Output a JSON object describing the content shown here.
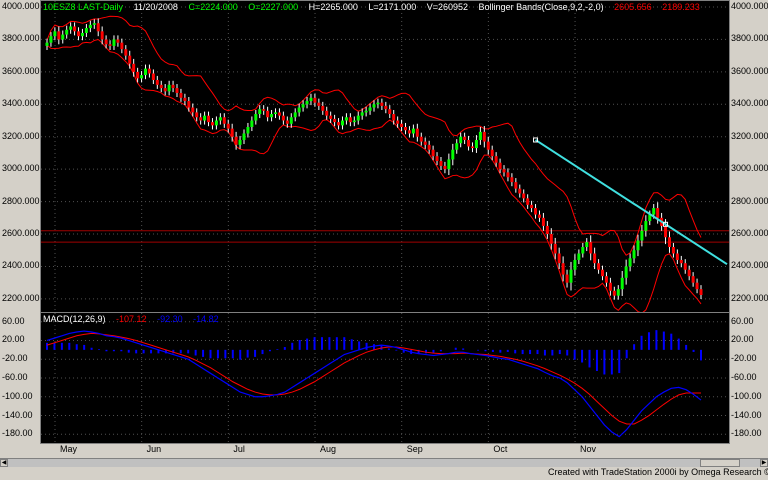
{
  "price_pane": {
    "header": {
      "symbol": "10ESZ8 LAST-Daily",
      "date": "11/20/2008",
      "close": "C=2224.000",
      "open": "O=2227.000",
      "high": "H=2265.000",
      "low": "L=2171.000",
      "volume": "V=260952",
      "indicator": "Bollinger Bands(Close,9,2,-2,0)",
      "upper": "2605.656",
      "lower": "2189.233"
    },
    "y_ticks": [
      "4000.000",
      "3800.000",
      "3600.000",
      "3400.000",
      "3200.000",
      "3000.000",
      "2800.000",
      "2600.000",
      "2400.000",
      "2200.000"
    ]
  },
  "macd_pane": {
    "header": {
      "label": "MACD(12,26,9)",
      "macd": "-107.12",
      "signal": "-92.30",
      "diff": "-14.82"
    },
    "y_ticks": [
      "60.00",
      "20.00",
      "-20.00",
      "-60.00",
      "-100.00",
      "-140.00",
      "-180.00"
    ]
  },
  "x_ticks": [
    "May",
    "Jun",
    "Jul",
    "Aug",
    "Sep",
    "Oct",
    "Nov"
  ],
  "footer": "Created with TradeStation 2000i by Omega Research © 1999",
  "colors": {
    "up": "#00ff00",
    "down": "#ff0000",
    "band": "#ff0000",
    "trend": "#40e0e0",
    "macd": "#0000ff",
    "signal": "#ff0000",
    "hist": "#0000ff",
    "green_text": "#00ff00",
    "red_text": "#ff0000",
    "blue_text": "#0000ff"
  },
  "chart_data": [
    {
      "type": "candlestick",
      "ylim": [
        2150,
        4000
      ],
      "yticks": [
        4000,
        3800,
        3600,
        3400,
        3200,
        3000,
        2800,
        2600,
        2400,
        2200
      ],
      "horizontal_lines": [
        2620,
        2550
      ],
      "trendline": {
        "from": {
          "i": 124,
          "value": 3180
        },
        "to": {
          "i": 157,
          "value": 2660
        }
      },
      "series": [
        {
          "name": "Close",
          "values": [
            3780,
            3820,
            3850,
            3800,
            3830,
            3860,
            3880,
            3850,
            3820,
            3840,
            3870,
            3890,
            3900,
            3850,
            3800,
            3770,
            3760,
            3800,
            3780,
            3740,
            3700,
            3650,
            3600,
            3560,
            3580,
            3620,
            3590,
            3550,
            3520,
            3500,
            3480,
            3520,
            3500,
            3470,
            3440,
            3420,
            3380,
            3350,
            3320,
            3300,
            3330,
            3290,
            3270,
            3300,
            3320,
            3280,
            3250,
            3200,
            3150,
            3180,
            3220,
            3260,
            3300,
            3340,
            3370,
            3360,
            3320,
            3340,
            3350,
            3330,
            3300,
            3280,
            3320,
            3350,
            3380,
            3400,
            3420,
            3440,
            3410,
            3390,
            3360,
            3330,
            3310,
            3290,
            3270,
            3300,
            3320,
            3290,
            3300,
            3330,
            3350,
            3360,
            3380,
            3400,
            3410,
            3390,
            3370,
            3340,
            3300,
            3280,
            3260,
            3240,
            3220,
            3250,
            3200,
            3170,
            3150,
            3120,
            3080,
            3050,
            3020,
            3000,
            3060,
            3120,
            3160,
            3200,
            3180,
            3140,
            3130,
            3180,
            3230,
            3170,
            3120,
            3080,
            3040,
            3000,
            2980,
            2950,
            2920,
            2880,
            2850,
            2820,
            2780,
            2760,
            2720,
            2700,
            2650,
            2600,
            2540,
            2480,
            2420,
            2350,
            2300,
            2380,
            2440,
            2480,
            2520,
            2550,
            2480,
            2420,
            2380,
            2340,
            2300,
            2250,
            2220,
            2260,
            2330,
            2400,
            2450,
            2500,
            2560,
            2620,
            2680,
            2720,
            2760,
            2700,
            2650,
            2580,
            2520,
            2480,
            2440,
            2420,
            2380,
            2340,
            2300,
            2260,
            2224
          ],
          "color": "#00ff00"
        }
      ]
    },
    {
      "type": "line",
      "title": "MACD(12,26,9)",
      "ylim": [
        -190,
        70
      ],
      "yticks": [
        60,
        20,
        -20,
        -60,
        -100,
        -140,
        -180
      ],
      "series": [
        {
          "name": "MACD",
          "values": [
            20,
            25,
            30,
            35,
            38,
            40,
            38,
            35,
            30,
            28,
            25,
            20,
            15,
            10,
            5,
            0,
            -5,
            -10,
            -15,
            -20,
            -30,
            -40,
            -50,
            -60,
            -70,
            -80,
            -90,
            -95,
            -100,
            -100,
            -98,
            -95,
            -90,
            -80,
            -70,
            -60,
            -50,
            -40,
            -30,
            -20,
            -10,
            -5,
            0,
            5,
            8,
            10,
            8,
            5,
            0,
            -5,
            -8,
            -10,
            -12,
            -10,
            -8,
            -5,
            -5,
            -8,
            -10,
            -12,
            -15,
            -18,
            -20,
            -25,
            -30,
            -35,
            -40,
            -48,
            -55,
            -60,
            -70,
            -85,
            -100,
            -120,
            -140,
            -160,
            -175,
            -185,
            -170,
            -150,
            -130,
            -115,
            -100,
            -90,
            -82,
            -80,
            -85,
            -95,
            -107
          ]
        },
        {
          "name": "Signal",
          "values": [
            10,
            15,
            20,
            25,
            30,
            33,
            35,
            34,
            32,
            30,
            27,
            24,
            20,
            15,
            10,
            5,
            0,
            -5,
            -10,
            -15,
            -22,
            -30,
            -38,
            -48,
            -58,
            -68,
            -76,
            -84,
            -90,
            -94,
            -96,
            -96,
            -94,
            -90,
            -84,
            -76,
            -68,
            -58,
            -48,
            -38,
            -28,
            -20,
            -12,
            -5,
            0,
            4,
            6,
            6,
            4,
            1,
            -2,
            -5,
            -7,
            -8,
            -8,
            -8,
            -7,
            -8,
            -9,
            -10,
            -12,
            -14,
            -17,
            -20,
            -24,
            -29,
            -34,
            -40,
            -47,
            -54,
            -62,
            -71,
            -82,
            -95,
            -110,
            -125,
            -140,
            -152,
            -158,
            -158,
            -150,
            -140,
            -128,
            -116,
            -105,
            -96,
            -92,
            -92,
            -92
          ]
        }
      ]
    }
  ]
}
